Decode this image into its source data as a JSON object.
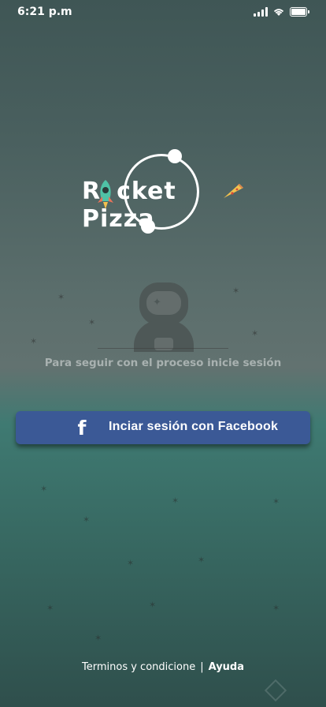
{
  "status_bar": {
    "time": "6:21 p.m"
  },
  "logo": {
    "text_before": "R",
    "text_after": "cket Pizza"
  },
  "hint_text": "Para seguir con el proceso  inicie sesión",
  "facebook_button": {
    "icon": "f",
    "label": "Inciar sesión con Facebook"
  },
  "footer": {
    "terms_label": "Terminos y condicione",
    "separator": "|",
    "help_label": "Ayuda"
  },
  "colors": {
    "facebook_blue": "#3b5996",
    "background_top": "#3f5655",
    "background_accent": "#3f7a72"
  }
}
